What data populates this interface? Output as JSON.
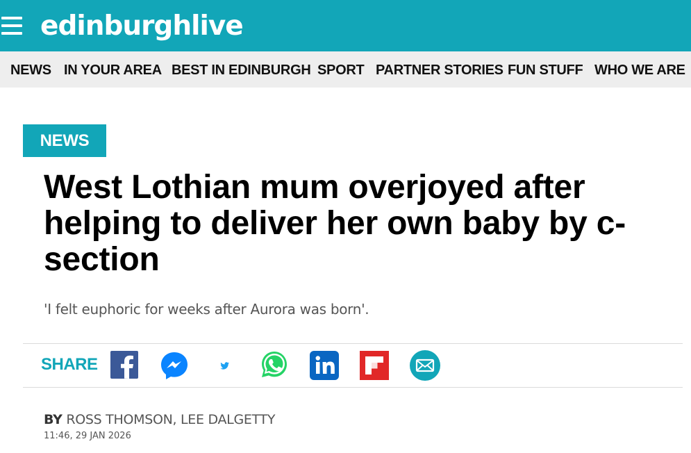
{
  "header": {
    "site_name": "edinburghlive",
    "brand_color": "#12a6b8",
    "menu_icon": "hamburger-menu-icon"
  },
  "nav": {
    "items": [
      {
        "label": "NEWS"
      },
      {
        "label": "IN YOUR AREA"
      },
      {
        "label": "BEST IN EDINBURGH"
      },
      {
        "label": "SPORT"
      },
      {
        "label": "PARTNER STORIES"
      },
      {
        "label": "FUN STUFF"
      },
      {
        "label": "WHO WE ARE"
      }
    ]
  },
  "article": {
    "section": "NEWS",
    "headline": "West Lothian mum overjoyed after helping to deliver her own baby by c-section",
    "standfirst": "'I felt euphoric for weeks after Aurora was born'.",
    "share": {
      "label": "SHARE",
      "buttons": [
        {
          "icon": "facebook-icon",
          "color": "#3b5998"
        },
        {
          "icon": "messenger-icon",
          "color": "#0a84ff"
        },
        {
          "icon": "twitter-icon",
          "color": "#1da1f2"
        },
        {
          "icon": "whatsapp-icon",
          "color": "#25d366"
        },
        {
          "icon": "linkedin-icon",
          "color": "#0a66c2"
        },
        {
          "icon": "flipboard-icon",
          "color": "#e12828"
        },
        {
          "icon": "email-icon",
          "color": "#12a6b8"
        }
      ]
    },
    "byline": {
      "prefix": "BY",
      "authors": "ROSS THOMSON, LEE DALGETTY"
    },
    "timestamp": "11:46, 29 JAN 2026"
  }
}
